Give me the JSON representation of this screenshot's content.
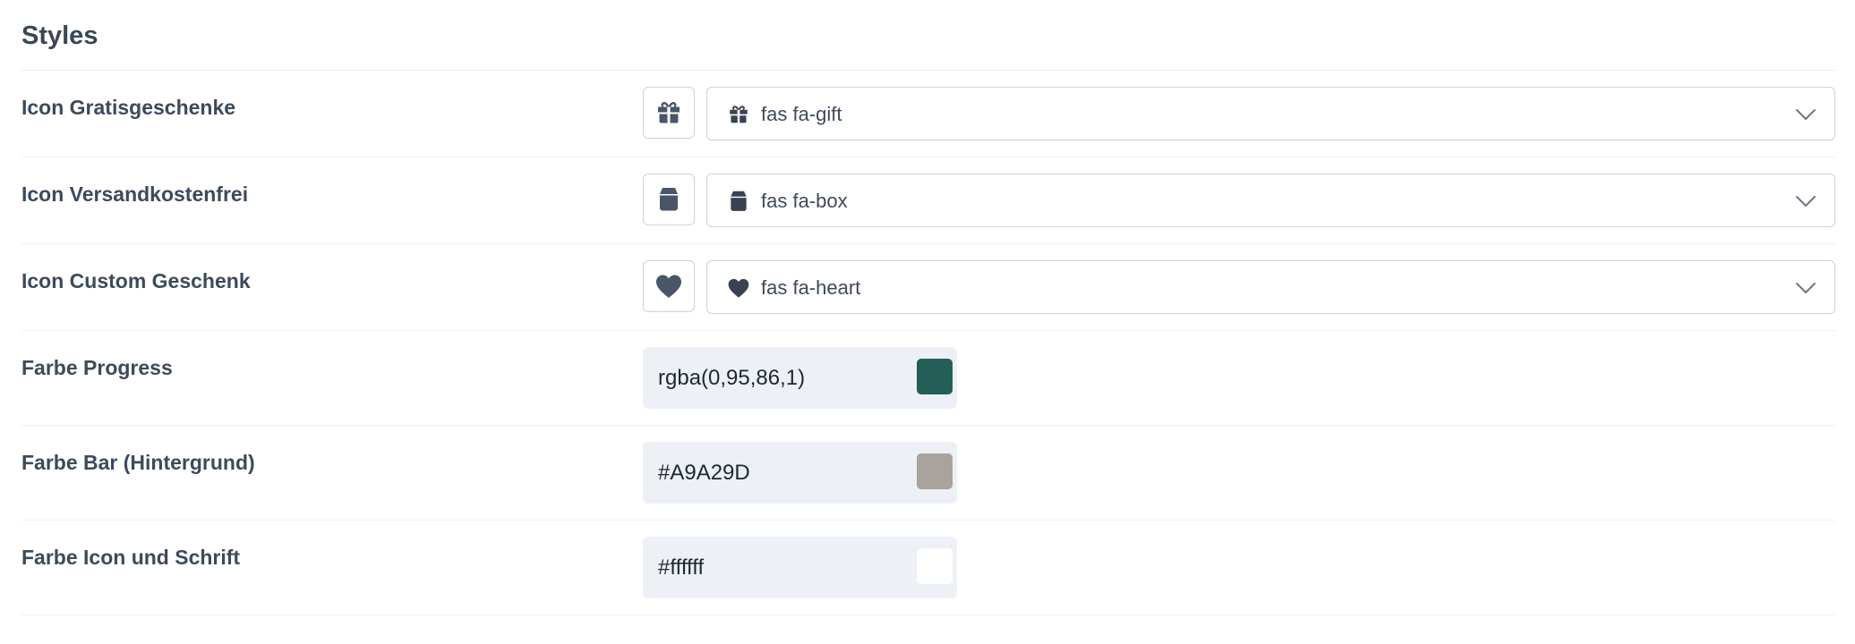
{
  "section": {
    "title": "Styles"
  },
  "icon_settings": [
    {
      "label": "Icon Gratisgeschenke",
      "value": "fas fa-gift",
      "icon": "gift-icon"
    },
    {
      "label": "Icon Versandkostenfrei",
      "value": "fas fa-box",
      "icon": "box-icon"
    },
    {
      "label": "Icon Custom Geschenk",
      "value": "fas fa-heart",
      "icon": "heart-icon"
    }
  ],
  "color_settings": [
    {
      "label": "Farbe Progress",
      "value": "rgba(0,95,86,1)",
      "swatch_color": "#245f57"
    },
    {
      "label": "Farbe Bar (Hintergrund)",
      "value": "#A9A29D",
      "swatch_color": "#A9A29D"
    },
    {
      "label": "Farbe Icon und Schrift",
      "value": "#ffffff",
      "swatch_color": "#ffffff"
    }
  ],
  "colors": {
    "icon": "#4a5568",
    "border": "#cdd3da",
    "input_bg": "#edf1f5"
  }
}
